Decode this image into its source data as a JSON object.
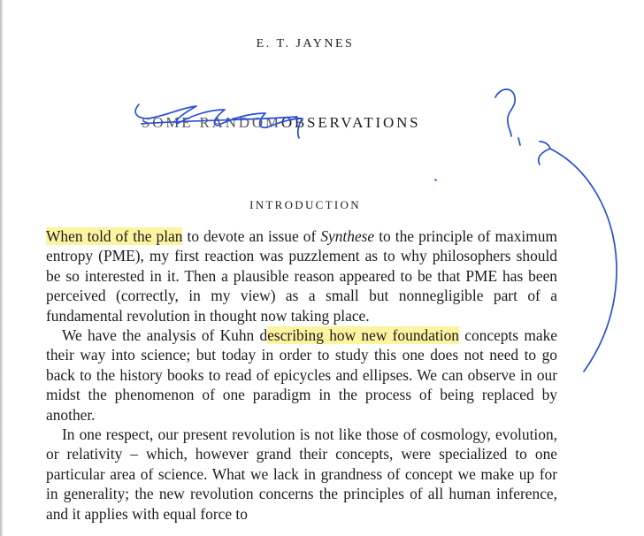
{
  "header": {
    "author": "E. T. JAYNES",
    "title_struck": "SOME RANDOM",
    "title_rest": "OBSERVATIONS"
  },
  "section": {
    "heading": "INTRODUCTION"
  },
  "paragraphs": [
    {
      "highlight_lead": "When told of the plan",
      "text_a": " to devote an issue of ",
      "italic": "Synthese",
      "text_b": " to the principle of maximum entropy (PME), my first reaction was puzzlement as to why philosophers should be so interested in it. Then a plausible reason appeared to be that PME has been perceived (correctly, in my view) as a small but nonnegligible part of a fundamental revolution in thought now taking place."
    },
    {
      "text_a": "We have the analysis of Kuhn d",
      "highlight": "escribing how new foundation",
      "text_b": " concepts make their way into science; but today in order to study this one does not need to go back to the history books to read of epicycles and ellipses. We can observe in our midst the phenomenon of one paradigm in the process of being replaced by another."
    },
    {
      "text": "In one respect, our present revolution is not like those of cosmology, evolution, or relativity – which, however grand their concepts, were specialized to one particular area of science. What we lack in grandness of concept we make up for in generality; the new revolution concerns the principles of all human inference, and it applies with equal force to"
    }
  ],
  "colors": {
    "highlight": "#fdf3a0",
    "annotation_ink": "#2a4fd6",
    "text": "#1c1c1c"
  },
  "annotations": {
    "marks": [
      "strike-through-scribble",
      "question-mark",
      "curved-arrow"
    ]
  }
}
